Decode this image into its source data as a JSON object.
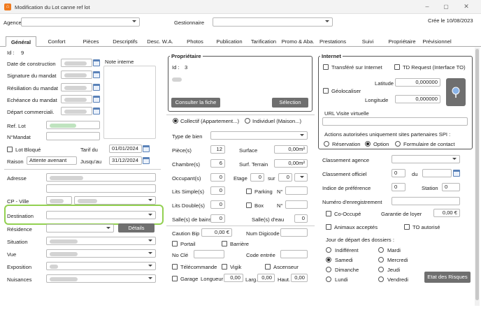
{
  "window": {
    "title": "Modification du Lot canne ref lot",
    "controls": [
      "–",
      "▢",
      "✕"
    ]
  },
  "top": {
    "agency_label": "Agence",
    "manager_label": "Gestionnaire",
    "created": "Crée le 10/08/2023"
  },
  "tabs": [
    "Général",
    "Confort",
    "Pièces",
    "Descriptifs",
    "Desc. W.A.",
    "Photos",
    "Publication",
    "Tarification",
    "Promo & Aba.",
    "Prestations",
    "Suivi",
    "Propriétaire",
    "Prévisionnel"
  ],
  "left": {
    "id_label": "Id :",
    "id_value": "9",
    "date_construction": "Date de construction",
    "signature_mandat": "Signature du mandat",
    "resiliation_mandat": "Résiliation du mandat",
    "echeance_mandat": "Echéance du mandat",
    "depart_commercial": "Départ commerciali.",
    "note_interne": "Note interne",
    "ref_lot": "Ref. Lot",
    "num_mandat": "N°Mandat",
    "lot_bloque": "Lot Bloqué",
    "tarif_du": "Tarif du",
    "tarif_du_value": "01/01/2024",
    "raison": "Raison",
    "raison_value": "Attente avenant",
    "jusquau": "Jusqu'au",
    "jusquau_value": "31/12/2024",
    "adresse": "Adresse",
    "cp_ville": "CP - Ville",
    "destination": "Destination",
    "residence": "Résidence",
    "details": "Détails",
    "situation": "Situation",
    "vue": "Vue",
    "exposition": "Exposition",
    "nuisances": "Nuisances"
  },
  "owner": {
    "title": "Propriétaire",
    "id_label": "Id :",
    "id_value": "3",
    "consult": "Consulter la fiche",
    "select": "Sélection"
  },
  "property": {
    "collectif": "Collectif (Appartement...)",
    "individuel": "Individuel (Maison...)",
    "type_bien": "Type de bien",
    "pieces": "Pièce(s)",
    "pieces_v": "12",
    "surface": "Surface",
    "surface_v": "0,00m²",
    "chambres": "Chambre(s)",
    "chambres_v": "6",
    "surf_terrain": "Surf. Terrain",
    "surf_terrain_v": "0,00m²",
    "occupants": "Occupant(s)",
    "occupants_v": "0",
    "etage": "Etage",
    "etage_v": "0",
    "sur": "sur",
    "sur_v": "0",
    "lits_simples": "Lits Simple(s)",
    "lits_simples_v": "0",
    "parking": "Parking",
    "n1": "N°",
    "lits_doubles": "Lits Double(s)",
    "lits_doubles_v": "0",
    "box": "Box",
    "n2": "N°",
    "salles_bains": "Salle(s) de bains",
    "salles_bains_v": "0",
    "salles_eau": "Salle(s) d'eau",
    "salles_eau_v": "0",
    "caution_bip": "Caution Bip",
    "caution_bip_v": "0,00 €",
    "num_digicode": "Num Digicode",
    "portail": "Portail",
    "barriere": "Barrière",
    "no_cle": "No Clé",
    "code_entree": "Code entrée",
    "telecommande": "Télécommande",
    "vigik": "Vigik",
    "ascenseur": "Ascenseur",
    "garage": "Garage",
    "longueur": "Longueur",
    "longueur_v": "0,00",
    "larg": "Larg.",
    "larg_v": "0,00",
    "haut": "Haut.",
    "haut_v": "0,00"
  },
  "internet": {
    "title": "Internet",
    "transfere": "Transféré sur Internet",
    "td_request": "TD Request (Interface TO)",
    "geolocaliser": "Géolocaliser",
    "latitude": "Latitude",
    "latitude_v": "0,000000",
    "longitude": "Longitude",
    "longitude_v": "0,000000",
    "url_visite": "URL Visite virtuelle",
    "actions": "Actions autorisées uniquement sites partenaires SPI :",
    "reservation": "Réservation",
    "option": "Option",
    "formulaire": "Formulaire de contact"
  },
  "right": {
    "classement_agence": "Classement agence",
    "classement_officiel": "Classement officiel",
    "classement_officiel_v": "0",
    "du": "du",
    "indice": "Indice de préférence",
    "indice_v": "0",
    "station": "Station",
    "station_v": "0",
    "num_enregistrement": "Numéro d'enregistrement",
    "co_occupe": "Co-Occupé",
    "garantie": "Garantie de loyer",
    "garantie_v": "0,00 €",
    "animaux": "Animaux acceptés",
    "to_autorise": "TO autorisé",
    "jour_depart": "Jour de départ des dossiers :",
    "days": [
      "Indifférent",
      "Mardi",
      "Samedi",
      "Mercredi",
      "Dimanche",
      "Jeudi",
      "Lundi",
      "Vendredi"
    ],
    "etat_risques": "Etat des Risques"
  }
}
